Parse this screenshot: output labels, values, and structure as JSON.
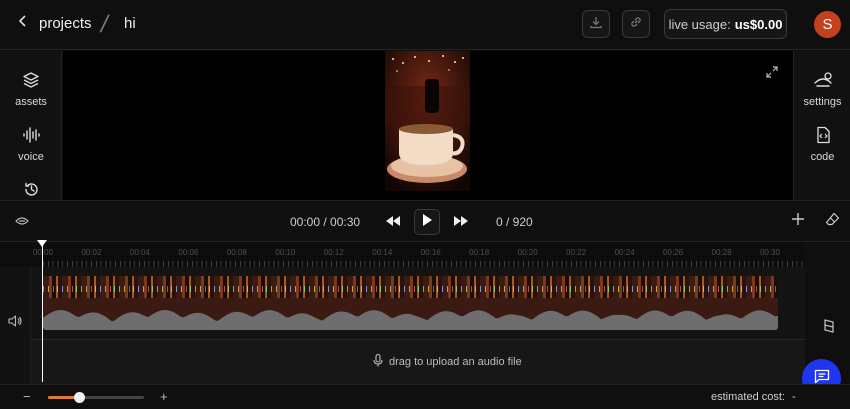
{
  "header": {
    "back_label": "projects",
    "project_name": "hi",
    "usage_label": "live usage:",
    "usage_value": "us$0.00",
    "avatar_initial": "S"
  },
  "left_nav": [
    {
      "label": "assets",
      "icon": "layers-icon"
    },
    {
      "label": "voice",
      "icon": "waveform-icon"
    },
    {
      "label": "",
      "icon": "history-icon"
    }
  ],
  "right_nav": [
    {
      "label": "settings",
      "icon": "settings-icon"
    },
    {
      "label": "code",
      "icon": "code-icon"
    }
  ],
  "playback": {
    "time": "00:00 / 00:30",
    "frames": "0 / 920"
  },
  "timeline": {
    "ruler_labels": [
      "00:00",
      "00:02",
      "00:04",
      "00:06",
      "00:08",
      "00:10",
      "00:12",
      "00:14",
      "00:16",
      "00:18",
      "00:20",
      "00:22",
      "00:24",
      "00:26",
      "00:28",
      "00:30"
    ],
    "upload_hint": "drag to upload an audio file"
  },
  "footer": {
    "zoom_minus": "−",
    "zoom_plus": "+",
    "zoom_level": 0.32,
    "cost_label": "estimated cost:",
    "cost_value": "-"
  },
  "colors": {
    "accent": "#e07a2e",
    "fab": "#1f36f0",
    "avatar": "#c4401f"
  }
}
